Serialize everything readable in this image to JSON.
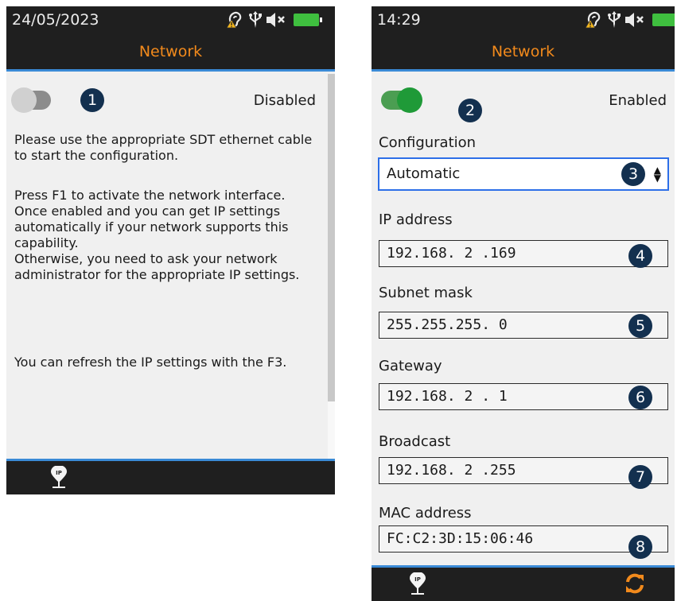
{
  "left_screen": {
    "status": {
      "time": "24/05/2023"
    },
    "title": "Network",
    "toggle_state": "Disabled",
    "badge": "1",
    "paragraphs": [
      "Please use the appropriate SDT ethernet cable to start the configuration.",
      "Press F1 to activate the network interface.\nOnce enabled and you can get IP settings automatically if your network supports this capability.\nOtherwise, you need to ask your network administrator for the appropriate IP settings.",
      "You can refresh the IP settings with the F3."
    ],
    "bottom_label": "IP"
  },
  "right_screen": {
    "status": {
      "time": "14:29"
    },
    "title": "Network",
    "toggle_state": "Enabled",
    "badges": [
      "2",
      "3",
      "4",
      "5",
      "6",
      "7",
      "8"
    ],
    "configuration": {
      "label": "Configuration",
      "value": "Automatic"
    },
    "ip_address": {
      "label": "IP address",
      "value": "192.168. 2 .169"
    },
    "subnet_mask": {
      "label": "Subnet mask",
      "value": "255.255.255. 0"
    },
    "gateway": {
      "label": "Gateway",
      "value": "192.168. 2 . 1"
    },
    "broadcast": {
      "label": "Broadcast",
      "value": "192.168. 2 .255"
    },
    "mac_address": {
      "label": "MAC address",
      "value": "FC:C2:3D:15:06:46"
    },
    "bottom_label": "IP"
  },
  "colors": {
    "title": "#f28a1c",
    "bar": "#1f1f1f",
    "accent_line": "#3a8ad6",
    "battery": "#3fbf3f",
    "toggle_on": "#1f9a38",
    "badge": "#13304f",
    "select_border": "#2d6fe8"
  },
  "icons": [
    "hearing-warning-icon",
    "usb-icon",
    "speaker-muted-icon",
    "battery-icon",
    "ip-pin-icon",
    "refresh-icon"
  ]
}
